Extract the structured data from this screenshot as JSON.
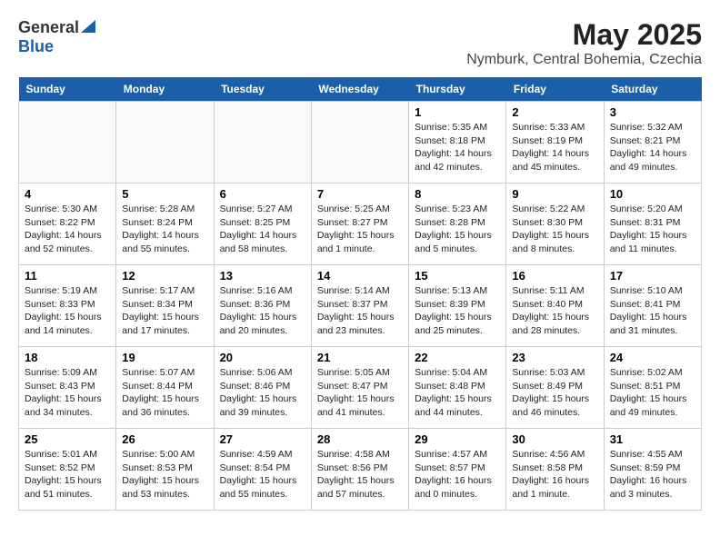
{
  "header": {
    "logo_general": "General",
    "logo_blue": "Blue",
    "title": "May 2025",
    "subtitle": "Nymburk, Central Bohemia, Czechia"
  },
  "days_of_week": [
    "Sunday",
    "Monday",
    "Tuesday",
    "Wednesday",
    "Thursday",
    "Friday",
    "Saturday"
  ],
  "weeks": [
    [
      {
        "day": "",
        "empty": true
      },
      {
        "day": "",
        "empty": true
      },
      {
        "day": "",
        "empty": true
      },
      {
        "day": "",
        "empty": true
      },
      {
        "day": "1",
        "sunrise": "Sunrise: 5:35 AM",
        "sunset": "Sunset: 8:18 PM",
        "daylight": "Daylight: 14 hours and 42 minutes."
      },
      {
        "day": "2",
        "sunrise": "Sunrise: 5:33 AM",
        "sunset": "Sunset: 8:19 PM",
        "daylight": "Daylight: 14 hours and 45 minutes."
      },
      {
        "day": "3",
        "sunrise": "Sunrise: 5:32 AM",
        "sunset": "Sunset: 8:21 PM",
        "daylight": "Daylight: 14 hours and 49 minutes."
      }
    ],
    [
      {
        "day": "4",
        "sunrise": "Sunrise: 5:30 AM",
        "sunset": "Sunset: 8:22 PM",
        "daylight": "Daylight: 14 hours and 52 minutes."
      },
      {
        "day": "5",
        "sunrise": "Sunrise: 5:28 AM",
        "sunset": "Sunset: 8:24 PM",
        "daylight": "Daylight: 14 hours and 55 minutes."
      },
      {
        "day": "6",
        "sunrise": "Sunrise: 5:27 AM",
        "sunset": "Sunset: 8:25 PM",
        "daylight": "Daylight: 14 hours and 58 minutes."
      },
      {
        "day": "7",
        "sunrise": "Sunrise: 5:25 AM",
        "sunset": "Sunset: 8:27 PM",
        "daylight": "Daylight: 15 hours and 1 minute."
      },
      {
        "day": "8",
        "sunrise": "Sunrise: 5:23 AM",
        "sunset": "Sunset: 8:28 PM",
        "daylight": "Daylight: 15 hours and 5 minutes."
      },
      {
        "day": "9",
        "sunrise": "Sunrise: 5:22 AM",
        "sunset": "Sunset: 8:30 PM",
        "daylight": "Daylight: 15 hours and 8 minutes."
      },
      {
        "day": "10",
        "sunrise": "Sunrise: 5:20 AM",
        "sunset": "Sunset: 8:31 PM",
        "daylight": "Daylight: 15 hours and 11 minutes."
      }
    ],
    [
      {
        "day": "11",
        "sunrise": "Sunrise: 5:19 AM",
        "sunset": "Sunset: 8:33 PM",
        "daylight": "Daylight: 15 hours and 14 minutes."
      },
      {
        "day": "12",
        "sunrise": "Sunrise: 5:17 AM",
        "sunset": "Sunset: 8:34 PM",
        "daylight": "Daylight: 15 hours and 17 minutes."
      },
      {
        "day": "13",
        "sunrise": "Sunrise: 5:16 AM",
        "sunset": "Sunset: 8:36 PM",
        "daylight": "Daylight: 15 hours and 20 minutes."
      },
      {
        "day": "14",
        "sunrise": "Sunrise: 5:14 AM",
        "sunset": "Sunset: 8:37 PM",
        "daylight": "Daylight: 15 hours and 23 minutes."
      },
      {
        "day": "15",
        "sunrise": "Sunrise: 5:13 AM",
        "sunset": "Sunset: 8:39 PM",
        "daylight": "Daylight: 15 hours and 25 minutes."
      },
      {
        "day": "16",
        "sunrise": "Sunrise: 5:11 AM",
        "sunset": "Sunset: 8:40 PM",
        "daylight": "Daylight: 15 hours and 28 minutes."
      },
      {
        "day": "17",
        "sunrise": "Sunrise: 5:10 AM",
        "sunset": "Sunset: 8:41 PM",
        "daylight": "Daylight: 15 hours and 31 minutes."
      }
    ],
    [
      {
        "day": "18",
        "sunrise": "Sunrise: 5:09 AM",
        "sunset": "Sunset: 8:43 PM",
        "daylight": "Daylight: 15 hours and 34 minutes."
      },
      {
        "day": "19",
        "sunrise": "Sunrise: 5:07 AM",
        "sunset": "Sunset: 8:44 PM",
        "daylight": "Daylight: 15 hours and 36 minutes."
      },
      {
        "day": "20",
        "sunrise": "Sunrise: 5:06 AM",
        "sunset": "Sunset: 8:46 PM",
        "daylight": "Daylight: 15 hours and 39 minutes."
      },
      {
        "day": "21",
        "sunrise": "Sunrise: 5:05 AM",
        "sunset": "Sunset: 8:47 PM",
        "daylight": "Daylight: 15 hours and 41 minutes."
      },
      {
        "day": "22",
        "sunrise": "Sunrise: 5:04 AM",
        "sunset": "Sunset: 8:48 PM",
        "daylight": "Daylight: 15 hours and 44 minutes."
      },
      {
        "day": "23",
        "sunrise": "Sunrise: 5:03 AM",
        "sunset": "Sunset: 8:49 PM",
        "daylight": "Daylight: 15 hours and 46 minutes."
      },
      {
        "day": "24",
        "sunrise": "Sunrise: 5:02 AM",
        "sunset": "Sunset: 8:51 PM",
        "daylight": "Daylight: 15 hours and 49 minutes."
      }
    ],
    [
      {
        "day": "25",
        "sunrise": "Sunrise: 5:01 AM",
        "sunset": "Sunset: 8:52 PM",
        "daylight": "Daylight: 15 hours and 51 minutes."
      },
      {
        "day": "26",
        "sunrise": "Sunrise: 5:00 AM",
        "sunset": "Sunset: 8:53 PM",
        "daylight": "Daylight: 15 hours and 53 minutes."
      },
      {
        "day": "27",
        "sunrise": "Sunrise: 4:59 AM",
        "sunset": "Sunset: 8:54 PM",
        "daylight": "Daylight: 15 hours and 55 minutes."
      },
      {
        "day": "28",
        "sunrise": "Sunrise: 4:58 AM",
        "sunset": "Sunset: 8:56 PM",
        "daylight": "Daylight: 15 hours and 57 minutes."
      },
      {
        "day": "29",
        "sunrise": "Sunrise: 4:57 AM",
        "sunset": "Sunset: 8:57 PM",
        "daylight": "Daylight: 16 hours and 0 minutes."
      },
      {
        "day": "30",
        "sunrise": "Sunrise: 4:56 AM",
        "sunset": "Sunset: 8:58 PM",
        "daylight": "Daylight: 16 hours and 1 minute."
      },
      {
        "day": "31",
        "sunrise": "Sunrise: 4:55 AM",
        "sunset": "Sunset: 8:59 PM",
        "daylight": "Daylight: 16 hours and 3 minutes."
      }
    ]
  ]
}
